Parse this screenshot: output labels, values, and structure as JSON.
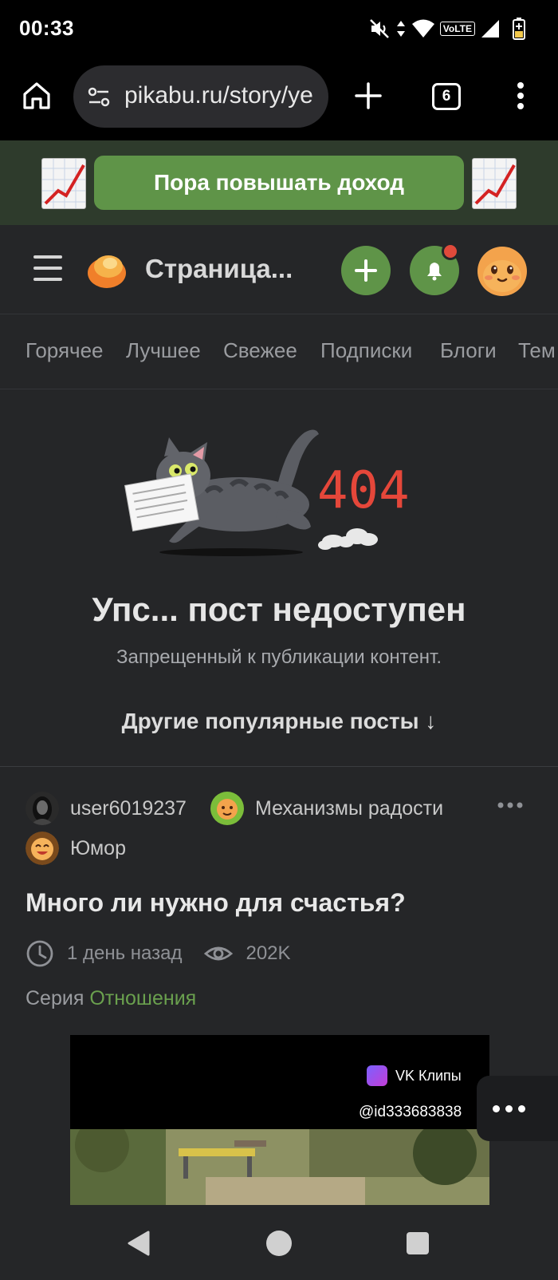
{
  "status_bar": {
    "time": "00:33",
    "icons": [
      "mute-icon",
      "data-arrows-icon",
      "wifi-icon",
      "volte-icon",
      "signal-icon",
      "battery-icon"
    ],
    "volte_label": "VoLTE"
  },
  "browser": {
    "url": "pikabu.ru/story/ye",
    "tab_count": "6",
    "icons": [
      "home-icon",
      "tune-icon",
      "plus-icon",
      "more-vertical-icon"
    ]
  },
  "ad": {
    "button_label": "Пора повышать доход"
  },
  "header": {
    "title": "Страница..."
  },
  "nav_tabs": [
    "Горячее",
    "Лучшее",
    "Свежее",
    "Подписки",
    "Блоги",
    "Тем"
  ],
  "error": {
    "code": "404",
    "title": "Упс... пост недоступен",
    "subtitle": "Запрещенный к публикации контент.",
    "popular_link": "Другие популярные посты ↓"
  },
  "post": {
    "author": "user6019237",
    "community": "Механизмы радости",
    "tag": "Юмор",
    "title": "Много ли нужно для счастья?",
    "time": "1 день назад",
    "views": "202K",
    "series_prefix": "Серия",
    "series_name": "Отношения",
    "video": {
      "source_label": "VK Клипы",
      "user_id": "@id333683838"
    }
  },
  "colors": {
    "accent_green": "#5f9448",
    "background": "#252628",
    "error_code": "#e5473a",
    "notification": "#e04a3b"
  }
}
